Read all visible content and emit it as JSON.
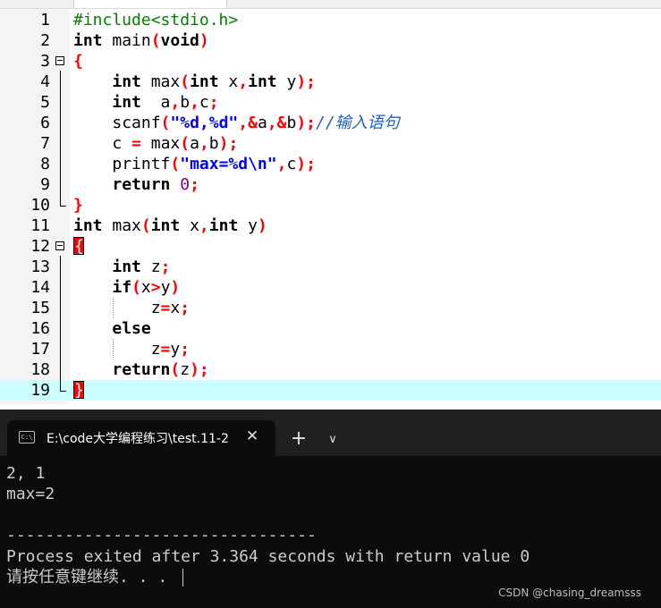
{
  "editor": {
    "current_line": 19,
    "line_numbers": [
      "1",
      "2",
      "3",
      "4",
      "5",
      "6",
      "7",
      "8",
      "9",
      "10",
      "11",
      "12",
      "13",
      "14",
      "15",
      "16",
      "17",
      "18",
      "19"
    ],
    "lines": {
      "l1": {
        "pre": "#include<stdio.h>"
      },
      "l2": {
        "kw1": "int",
        "t1": " main",
        "s1": "(",
        "kw2": "void",
        "s2": ")"
      },
      "l3": {
        "s1": "{"
      },
      "l4": {
        "indent": "    ",
        "kw1": "int",
        "t1": " max",
        "s1": "(",
        "kw2": "int",
        "t2": " x",
        "s2": ",",
        "kw3": "int",
        "t3": " y",
        "s3": ");"
      },
      "l5": {
        "indent": "    ",
        "kw1": "int",
        "t1": "  a",
        "s1": ",",
        "t2": "b",
        "s2": ",",
        "t3": "c",
        "s3": ";"
      },
      "l6": {
        "indent": "    ",
        "t1": "scanf",
        "s1": "(",
        "str1": "\"%d,%d\"",
        "s2": ",&",
        "t2": "a",
        "s3": ",&",
        "t3": "b",
        "s4": ");",
        "cmt": "//输入语句"
      },
      "l7": {
        "indent": "    ",
        "t1": "c ",
        "s1": "=",
        "t2": " max",
        "s2": "(",
        "t3": "a",
        "s3": ",",
        "t4": "b",
        "s4": ");"
      },
      "l8": {
        "indent": "    ",
        "t1": "printf",
        "s1": "(",
        "str1": "\"max=%d\\n\"",
        "s2": ",",
        "t2": "c",
        "s3": ");"
      },
      "l9": {
        "indent": "    ",
        "kw1": "return",
        "sp": " ",
        "num": "0",
        "s1": ";"
      },
      "l10": {
        "s1": "}"
      },
      "l11": {
        "kw1": "int",
        "t1": " max",
        "s1": "(",
        "kw2": "int",
        "t2": " x",
        "s2": ",",
        "kw3": "int",
        "t3": " y",
        "s3": ")"
      },
      "l12": {
        "brace": "{"
      },
      "l13": {
        "indent": "    ",
        "kw1": "int",
        "t1": " z",
        "s1": ";"
      },
      "l14": {
        "indent": "    ",
        "kw1": "if",
        "s1": "(",
        "t1": "x",
        "s2": ">",
        "t2": "y",
        "s3": ")"
      },
      "l15": {
        "indent": "        ",
        "t1": "z",
        "s1": "=",
        "t2": "x",
        "s2": ";"
      },
      "l16": {
        "indent": "    ",
        "kw1": "else"
      },
      "l17": {
        "indent": "        ",
        "t1": "z",
        "s1": "=",
        "t2": "y",
        "s2": ";"
      },
      "l18": {
        "indent": "    ",
        "kw1": "return",
        "s1": "(",
        "t1": "z",
        "s2": ");"
      },
      "l19": {
        "brace": "}"
      }
    }
  },
  "terminal": {
    "tab_title": "E:\\code大学编程练习\\test.11-2",
    "tab_icon_text": "C:\\",
    "close_glyph": "✕",
    "new_tab_glyph": "+",
    "dropdown_glyph": "∨",
    "output": [
      "2, 1",
      "max=2",
      "",
      "--------------------------------",
      "Process exited after 3.364 seconds with return value 0",
      "请按任意键继续. . . "
    ],
    "watermark": "CSDN @chasing_dreamsss"
  },
  "colors": {
    "keyword": "#000000",
    "preprocessor": "#008000",
    "symbol": "#ff0000",
    "string": "#0000ff",
    "number": "#800080",
    "comment": "#2060c0",
    "current_line_bg": "#ccffff",
    "terminal_bg": "#0c0c0c"
  },
  "icons": {
    "fold": "fold-minus-icon",
    "tab": "terminal-tab-icon",
    "close": "close-icon",
    "new_tab": "plus-icon",
    "dropdown": "chevron-down-icon"
  }
}
